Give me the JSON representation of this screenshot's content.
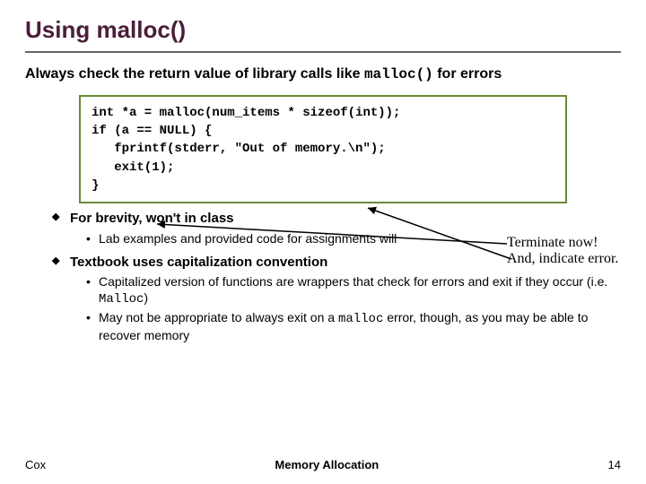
{
  "title": "Using malloc()",
  "lead_a": "Always check the return value of library calls like ",
  "lead_mono": "malloc()",
  "lead_b": " for errors",
  "code": "int *a = malloc(num_items * sizeof(int));\nif (a == NULL) {\n   fprintf(stderr, \"Out of memory.\\n\");\n   exit(1);\n}",
  "annotation_l1": "Terminate now!",
  "annotation_l2": "And, indicate error.",
  "b1": "For brevity, won't in class",
  "b1_s1": "Lab examples and provided code for assignments will",
  "b2": "Textbook uses capitalization convention",
  "b2_s1_a": "Capitalized version of functions are wrappers that check for errors and exit if they occur (i.e. ",
  "b2_s1_mono": "Malloc",
  "b2_s1_b": ")",
  "b2_s2_a": "May not be appropriate to always exit on a ",
  "b2_s2_mono": "malloc",
  "b2_s2_b": " error, though, as you may be able to recover memory",
  "footer_left": "Cox",
  "footer_mid": "Memory Allocation",
  "footer_right": "14"
}
